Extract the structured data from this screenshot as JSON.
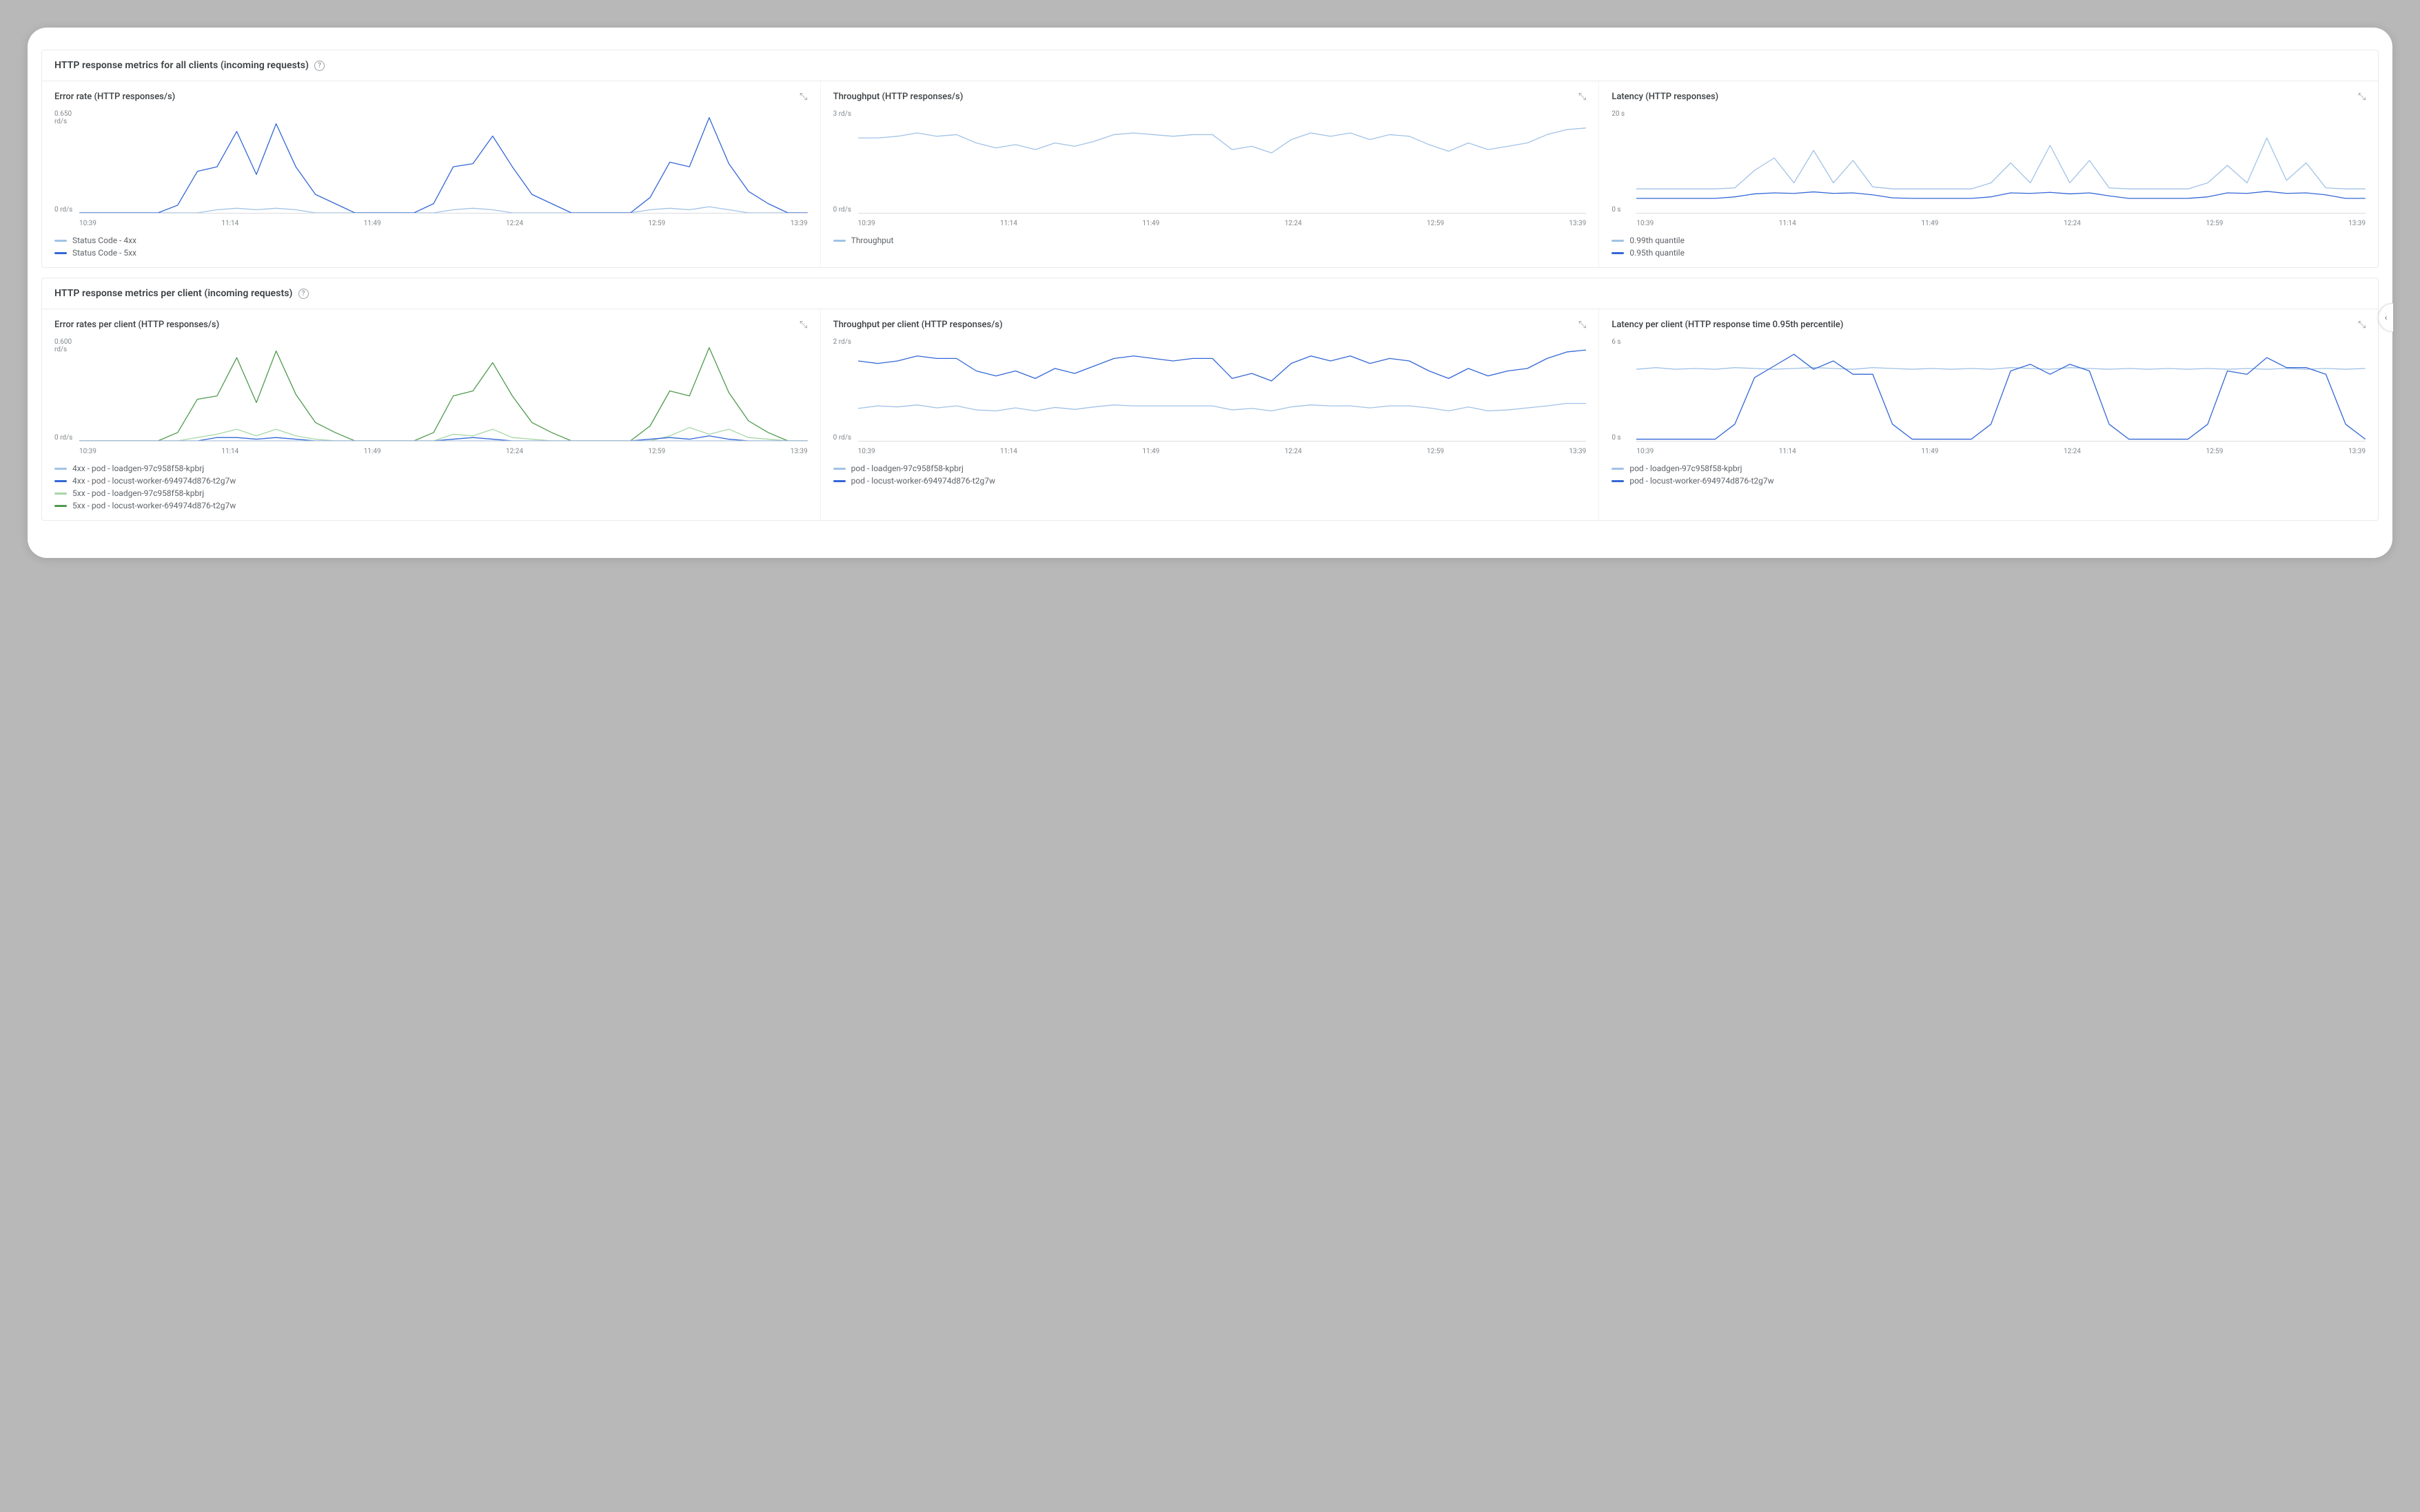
{
  "sections": [
    {
      "title": "HTTP response metrics for all clients (incoming requests)",
      "charts": [
        "error_rate_all",
        "throughput_all",
        "latency_all"
      ]
    },
    {
      "title": "HTTP response metrics per client (incoming requests)",
      "charts": [
        "error_rate_per",
        "throughput_per",
        "latency_per"
      ]
    }
  ],
  "x_ticks": [
    "10:39",
    "11:14",
    "11:49",
    "12:24",
    "12:59",
    "13:39"
  ],
  "colors": {
    "blue_light": "#a1c2e6",
    "blue_mid": "#3367d6",
    "blue_dark": "#1a4aa8",
    "green_light": "#a6d6a6",
    "green_dark": "#4e9a4e"
  },
  "chart_data": [
    {
      "id": "error_rate_all",
      "title": "Error rate (HTTP responses/s)",
      "type": "line",
      "yTopLabel": "0.650\nrd/s",
      "yBottomLabel": "0 rd/s",
      "ylim": [
        0,
        0.65
      ],
      "legend": [
        {
          "name": "Status Code - 4xx",
          "colorKey": "blue_light"
        },
        {
          "name": "Status Code - 5xx",
          "colorKey": "blue_mid"
        }
      ],
      "series": [
        {
          "name": "Status Code - 4xx",
          "colorKey": "blue_light",
          "values": [
            0,
            0,
            0,
            0,
            0,
            0,
            0,
            0.02,
            0.03,
            0.02,
            0.03,
            0.02,
            0,
            0,
            0,
            0,
            0,
            0,
            0,
            0.02,
            0.03,
            0.02,
            0,
            0,
            0,
            0,
            0,
            0,
            0,
            0.02,
            0.03,
            0.02,
            0.04,
            0.02,
            0,
            0,
            0,
            0
          ]
        },
        {
          "name": "Status Code - 5xx",
          "colorKey": "blue_mid",
          "values": [
            0,
            0,
            0,
            0,
            0,
            0.05,
            0.27,
            0.3,
            0.53,
            0.25,
            0.58,
            0.3,
            0.12,
            0.06,
            0,
            0,
            0,
            0,
            0.06,
            0.3,
            0.32,
            0.5,
            0.3,
            0.12,
            0.06,
            0,
            0,
            0,
            0,
            0.1,
            0.33,
            0.3,
            0.62,
            0.32,
            0.14,
            0.06,
            0,
            0
          ]
        }
      ]
    },
    {
      "id": "throughput_all",
      "title": "Throughput (HTTP responses/s)",
      "type": "line",
      "yTopLabel": "3 rd/s",
      "yBottomLabel": "0 rd/s",
      "ylim": [
        0,
        3
      ],
      "legend": [
        {
          "name": "Throughput",
          "colorKey": "blue_light"
        }
      ],
      "series": [
        {
          "name": "Throughput",
          "colorKey": "blue_light",
          "values": [
            2.25,
            2.25,
            2.3,
            2.4,
            2.3,
            2.35,
            2.1,
            1.95,
            2.05,
            1.9,
            2.1,
            2.0,
            2.15,
            2.35,
            2.4,
            2.35,
            2.3,
            2.35,
            2.35,
            1.9,
            2.0,
            1.8,
            2.2,
            2.4,
            2.3,
            2.4,
            2.2,
            2.35,
            2.3,
            2.05,
            1.85,
            2.1,
            1.9,
            2.0,
            2.1,
            2.35,
            2.5,
            2.55
          ]
        }
      ]
    },
    {
      "id": "latency_all",
      "title": "Latency (HTTP responses)",
      "type": "line",
      "yTopLabel": "20 s",
      "yBottomLabel": "0 s",
      "ylim": [
        0,
        20
      ],
      "legend": [
        {
          "name": "0.99th quantile",
          "colorKey": "blue_light"
        },
        {
          "name": "0.95th quantile",
          "colorKey": "blue_mid"
        }
      ],
      "series": [
        {
          "name": "0.99th quantile",
          "colorKey": "blue_light",
          "values": [
            4.8,
            4.8,
            4.8,
            4.8,
            4.8,
            5.0,
            8.5,
            11.0,
            6.0,
            12.5,
            6.0,
            10.5,
            5.2,
            4.8,
            4.8,
            4.8,
            4.8,
            4.8,
            6.0,
            10.0,
            6.0,
            13.5,
            6.0,
            10.5,
            5.0,
            4.8,
            4.8,
            4.8,
            4.8,
            6.0,
            9.5,
            6.0,
            15.0,
            6.5,
            10.0,
            5.0,
            4.8,
            4.8
          ]
        },
        {
          "name": "0.95th quantile",
          "colorKey": "blue_mid",
          "values": [
            2.9,
            2.9,
            2.9,
            2.9,
            2.9,
            3.2,
            3.8,
            4.0,
            3.9,
            4.2,
            3.9,
            4.0,
            3.6,
            3.0,
            2.9,
            2.9,
            2.9,
            2.9,
            3.2,
            4.0,
            3.9,
            4.1,
            3.8,
            4.0,
            3.4,
            2.9,
            2.9,
            2.9,
            2.9,
            3.2,
            4.0,
            3.9,
            4.3,
            3.9,
            4.0,
            3.6,
            2.9,
            2.9
          ]
        }
      ]
    },
    {
      "id": "error_rate_per",
      "title": "Error rates per client (HTTP responses/s)",
      "type": "line",
      "yTopLabel": "0.600\nrd/s",
      "yBottomLabel": "0 rd/s",
      "ylim": [
        0,
        0.6
      ],
      "legend": [
        {
          "name": "4xx - pod - loadgen-97c958f58-kpbrj",
          "colorKey": "blue_light"
        },
        {
          "name": "4xx - pod - locust-worker-694974d876-t2g7w",
          "colorKey": "blue_mid"
        },
        {
          "name": "5xx - pod - loadgen-97c958f58-kpbrj",
          "colorKey": "green_light"
        },
        {
          "name": "5xx - pod - locust-worker-694974d876-t2g7w",
          "colorKey": "green_dark"
        }
      ],
      "series": [
        {
          "name": "5xx locust",
          "colorKey": "green_dark",
          "values": [
            0,
            0,
            0,
            0,
            0,
            0.05,
            0.25,
            0.27,
            0.5,
            0.23,
            0.54,
            0.28,
            0.11,
            0.05,
            0,
            0,
            0,
            0,
            0.05,
            0.27,
            0.3,
            0.47,
            0.27,
            0.11,
            0.05,
            0,
            0,
            0,
            0,
            0.09,
            0.3,
            0.27,
            0.56,
            0.29,
            0.12,
            0.05,
            0,
            0
          ]
        },
        {
          "name": "5xx loadgen",
          "colorKey": "green_light",
          "values": [
            0,
            0,
            0,
            0,
            0,
            0,
            0.02,
            0.04,
            0.07,
            0.03,
            0.07,
            0.03,
            0.01,
            0,
            0,
            0,
            0,
            0,
            0,
            0.04,
            0.03,
            0.07,
            0.02,
            0.01,
            0,
            0,
            0,
            0,
            0,
            0,
            0.03,
            0.08,
            0.04,
            0.07,
            0.02,
            0.01,
            0,
            0
          ]
        },
        {
          "name": "4xx locust",
          "colorKey": "blue_mid",
          "values": [
            0,
            0,
            0,
            0,
            0,
            0,
            0,
            0.02,
            0.02,
            0.01,
            0.02,
            0.01,
            0,
            0,
            0,
            0,
            0,
            0,
            0,
            0.01,
            0.02,
            0.01,
            0,
            0,
            0,
            0,
            0,
            0,
            0,
            0.01,
            0.02,
            0.01,
            0.03,
            0.01,
            0,
            0,
            0,
            0
          ]
        },
        {
          "name": "4xx loadgen",
          "colorKey": "blue_light",
          "values": [
            0,
            0,
            0,
            0,
            0,
            0,
            0,
            0,
            0,
            0,
            0,
            0,
            0,
            0,
            0,
            0,
            0,
            0,
            0,
            0,
            0,
            0,
            0,
            0,
            0,
            0,
            0,
            0,
            0,
            0,
            0,
            0,
            0,
            0,
            0,
            0,
            0,
            0
          ]
        }
      ]
    },
    {
      "id": "throughput_per",
      "title": "Throughput per client (HTTP responses/s)",
      "type": "line",
      "yTopLabel": "2 rd/s",
      "yBottomLabel": "0 rd/s",
      "ylim": [
        0,
        2
      ],
      "legend": [
        {
          "name": "pod - loadgen-97c958f58-kpbrj",
          "colorKey": "blue_light"
        },
        {
          "name": "pod - locust-worker-694974d876-t2g7w",
          "colorKey": "blue_mid"
        }
      ],
      "series": [
        {
          "name": "locust",
          "colorKey": "blue_mid",
          "values": [
            1.6,
            1.55,
            1.6,
            1.7,
            1.65,
            1.65,
            1.4,
            1.3,
            1.4,
            1.25,
            1.45,
            1.35,
            1.5,
            1.65,
            1.7,
            1.65,
            1.6,
            1.65,
            1.65,
            1.25,
            1.35,
            1.2,
            1.55,
            1.7,
            1.6,
            1.7,
            1.55,
            1.65,
            1.6,
            1.4,
            1.25,
            1.45,
            1.3,
            1.4,
            1.45,
            1.65,
            1.78,
            1.82
          ]
        },
        {
          "name": "loadgen",
          "colorKey": "blue_light",
          "values": [
            0.65,
            0.7,
            0.68,
            0.72,
            0.66,
            0.7,
            0.62,
            0.6,
            0.66,
            0.6,
            0.67,
            0.63,
            0.68,
            0.72,
            0.7,
            0.7,
            0.7,
            0.7,
            0.7,
            0.62,
            0.65,
            0.6,
            0.68,
            0.72,
            0.7,
            0.7,
            0.66,
            0.7,
            0.7,
            0.66,
            0.6,
            0.68,
            0.6,
            0.62,
            0.66,
            0.7,
            0.75,
            0.75
          ]
        }
      ]
    },
    {
      "id": "latency_per",
      "title": "Latency per client (HTTP response time 0.95th percentile)",
      "type": "line",
      "yTopLabel": "6 s",
      "yBottomLabel": "0 s",
      "ylim": [
        0,
        6
      ],
      "legend": [
        {
          "name": "pod - loadgen-97c958f58-kpbrj",
          "colorKey": "blue_light"
        },
        {
          "name": "pod - locust-worker-694974d876-t2g7w",
          "colorKey": "blue_mid"
        }
      ],
      "series": [
        {
          "name": "loadgen",
          "colorKey": "blue_light",
          "values": [
            4.3,
            4.4,
            4.3,
            4.35,
            4.3,
            4.4,
            4.35,
            4.3,
            4.35,
            4.4,
            4.35,
            4.3,
            4.4,
            4.35,
            4.3,
            4.35,
            4.3,
            4.35,
            4.3,
            4.4,
            4.35,
            4.3,
            4.4,
            4.35,
            4.3,
            4.35,
            4.3,
            4.35,
            4.3,
            4.35,
            4.3,
            4.35,
            4.3,
            4.35,
            4.3,
            4.35,
            4.3,
            4.35
          ]
        },
        {
          "name": "locust",
          "colorKey": "blue_mid",
          "values": [
            0.1,
            0.1,
            0.1,
            0.1,
            0.1,
            1.0,
            3.8,
            4.5,
            5.2,
            4.3,
            4.8,
            4.0,
            4.0,
            1.0,
            0.1,
            0.1,
            0.1,
            0.1,
            1.0,
            4.2,
            4.6,
            4.0,
            4.6,
            4.2,
            1.0,
            0.1,
            0.1,
            0.1,
            0.1,
            1.0,
            4.2,
            4.0,
            5.0,
            4.4,
            4.4,
            4.0,
            1.0,
            0.1
          ]
        }
      ]
    }
  ]
}
